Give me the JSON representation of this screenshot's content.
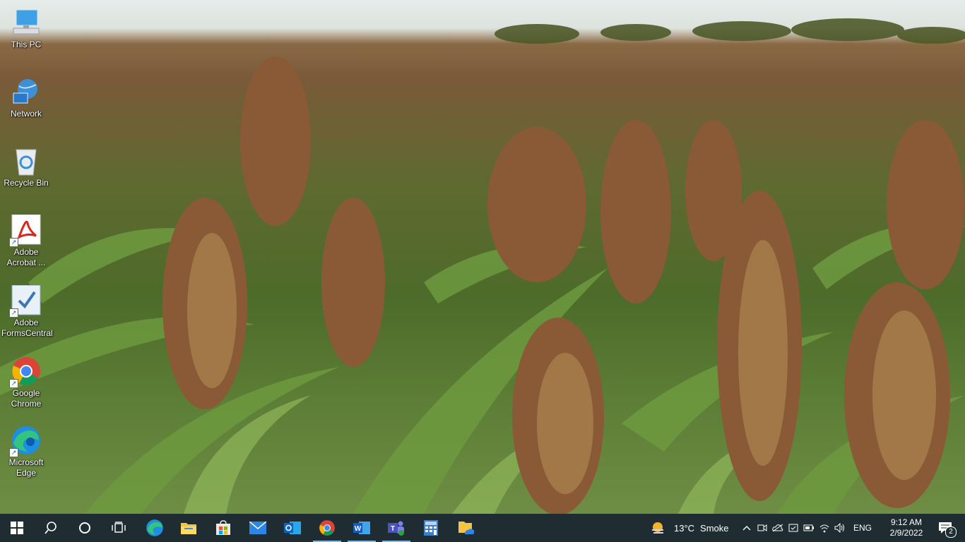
{
  "desktop": {
    "icons": [
      {
        "label": "This PC",
        "icon": "this-pc-icon"
      },
      {
        "label": "Network",
        "icon": "network-icon"
      },
      {
        "label": "Recycle Bin",
        "icon": "recycle-bin-icon"
      },
      {
        "label": "Adobe Acrobat ...",
        "icon": "adobe-acrobat-icon"
      },
      {
        "label": "Adobe FormsCentral",
        "icon": "adobe-formscentral-icon"
      },
      {
        "label": "Google Chrome",
        "icon": "google-chrome-icon"
      },
      {
        "label": "Microsoft Edge",
        "icon": "microsoft-edge-icon"
      }
    ]
  },
  "taskbar": {
    "pinned": [
      "start-icon",
      "search-icon",
      "cortana-icon",
      "task-view-icon",
      "edge-icon",
      "file-explorer-icon",
      "store-icon",
      "mail-icon",
      "outlook-icon",
      "chrome-icon",
      "word-icon",
      "teams-icon",
      "calculator-icon",
      "onedrive-folder-icon"
    ],
    "weather": {
      "temp": "13°C",
      "condition": "Smoke"
    },
    "language": "ENG",
    "clock": {
      "time": "9:12 AM",
      "date": "2/9/2022"
    },
    "notifications": {
      "count": "2"
    }
  },
  "colors": {
    "taskbar": "#1f2d33",
    "accent": "#7fb6e6"
  }
}
